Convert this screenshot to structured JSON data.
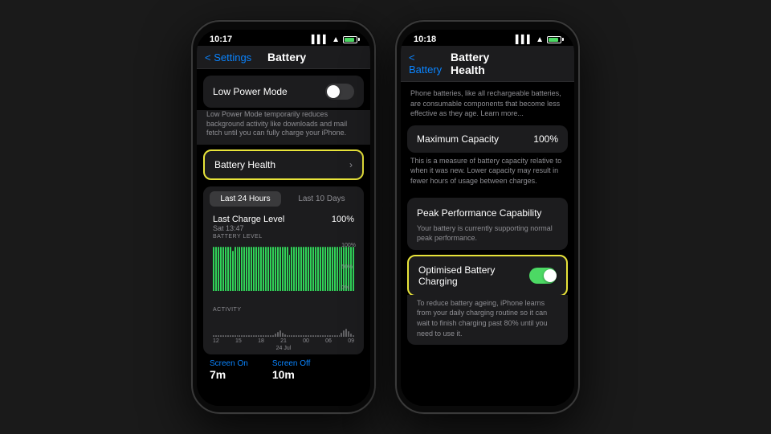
{
  "phone1": {
    "status": {
      "time": "10:17",
      "battery_pct": "100"
    },
    "nav": {
      "back_label": "< Settings",
      "title": "Battery"
    },
    "low_power_mode": {
      "label": "Low Power Mode",
      "desc": "Low Power Mode temporarily reduces background activity like downloads and mail fetch until you can fully charge your iPhone."
    },
    "battery_health": {
      "label": "Battery Health"
    },
    "chart": {
      "tab1": "Last 24 Hours",
      "tab2": "Last 10 Days",
      "charge_label": "Last Charge Level",
      "charge_value": "100%",
      "charge_date": "Sat 13:47",
      "battery_level_label": "BATTERY LEVEL",
      "activity_label": "ACTIVITY",
      "x_labels": [
        "12",
        "15",
        "18",
        "21",
        "00",
        "06",
        "09"
      ],
      "x_sub": "24 Jul",
      "y_labels": [
        "100%",
        "50%",
        "0%"
      ],
      "screen_on_label": "Screen On",
      "screen_on_value": "7m",
      "screen_off_label": "Screen Off",
      "screen_off_value": "10m"
    }
  },
  "phone2": {
    "status": {
      "time": "10:18"
    },
    "nav": {
      "back_label": "< Battery",
      "title": "Battery Health"
    },
    "intro_desc": "Phone batteries, like all rechargeable batteries, are consumable components that become less effective as they age. Learn more...",
    "max_capacity": {
      "label": "Maximum Capacity",
      "value": "100%",
      "desc": "This is a measure of battery capacity relative to when it was new. Lower capacity may result in fewer hours of usage between charges."
    },
    "peak_performance": {
      "label": "Peak Performance Capability",
      "desc": "Your battery is currently supporting normal peak performance."
    },
    "opt_charging": {
      "label": "Optimised Battery Charging",
      "desc": "To reduce battery ageing, iPhone learns from your daily charging routine so it can wait to finish charging past 80% until you need to use it.",
      "enabled": true
    }
  }
}
